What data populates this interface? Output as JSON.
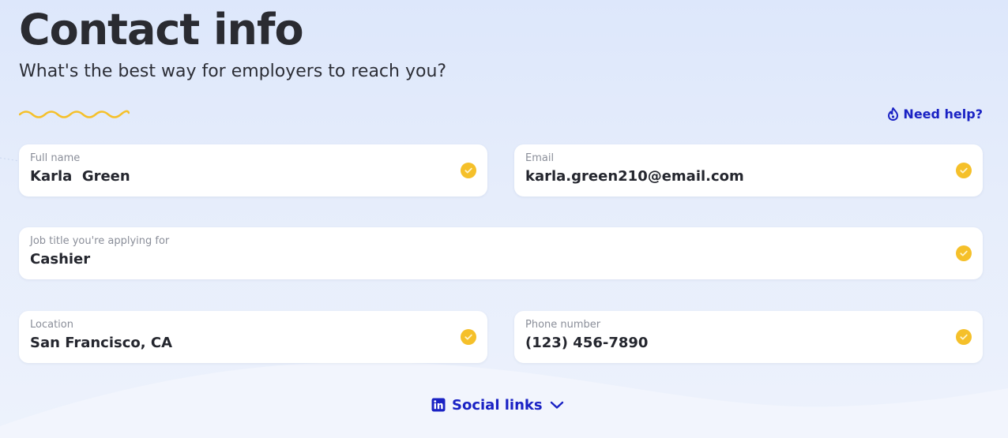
{
  "header": {
    "title": "Contact info",
    "subtitle": "What's the best way for employers to reach you?"
  },
  "help": {
    "label": "Need help?",
    "icon": "fire-icon"
  },
  "fields": {
    "full_name": {
      "label": "Full name",
      "value": "Karla  Green"
    },
    "email": {
      "label": "Email",
      "value": "karla.green210@email.com"
    },
    "job_title": {
      "label": "Job title you're applying for",
      "value": "Cashier"
    },
    "location": {
      "label": "Location",
      "value": "San Francisco, CA"
    },
    "phone": {
      "label": "Phone number",
      "value": "(123) 456-7890"
    }
  },
  "social": {
    "label": "Social links",
    "icon": "linkedin-icon",
    "chevron": "chevron-down-icon"
  },
  "colors": {
    "accent": "#1a22c4",
    "check": "#f5c02a",
    "squiggle": "#f5c02a",
    "background": "#e3ebfb"
  }
}
